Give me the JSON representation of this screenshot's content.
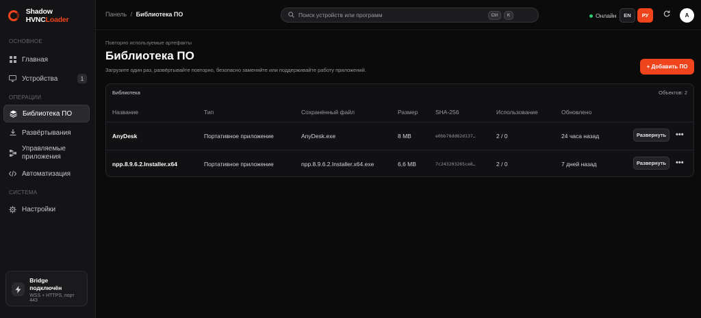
{
  "app": {
    "brand_main": "Shadow HVNC",
    "brand_accent": "Loader",
    "accent_color": "#f0451c"
  },
  "sidebar": {
    "sections": [
      {
        "label": "ОСНОВНОЕ",
        "items": [
          {
            "label": "Главная",
            "icon": "grid-icon"
          },
          {
            "label": "Устройства",
            "icon": "monitor-icon",
            "badge": "1"
          }
        ]
      },
      {
        "label": "ОПЕРАЦИИ",
        "items": [
          {
            "label": "Библиотека ПО",
            "icon": "layers-icon",
            "active": true
          },
          {
            "label": "Развёртывания",
            "icon": "download-icon"
          },
          {
            "label": "Управляемые приложения",
            "icon": "network-icon"
          },
          {
            "label": "Автоматизация",
            "icon": "code-icon"
          }
        ]
      },
      {
        "label": "СИСТЕМА",
        "items": [
          {
            "label": "Настройки",
            "icon": "gear-icon"
          }
        ]
      }
    ],
    "bridge": {
      "title_line1": "Bridge",
      "title_line2": "подключён",
      "subtitle": "WSS + HTTPS, порт 443",
      "icon": "bolt-icon"
    }
  },
  "topbar": {
    "breadcrumb_root": "Панель",
    "breadcrumb_sep": "/",
    "breadcrumb_current": "Библиотека ПО",
    "search_placeholder": "Поиск устройств или программ",
    "kbd_ctrl": "Ctrl",
    "kbd_k": "K",
    "status": "Онлайн",
    "status_color": "#2ecc71",
    "lang_en": "EN",
    "lang_ru": "РУ",
    "avatar": "A"
  },
  "main": {
    "eyebrow": "Повторно используемые артефакты",
    "title": "Библиотека ПО",
    "description": "Загрузите один раз, развёртывайте повторно, безопасно заменяйте или поддерживайте работу приложений.",
    "add_button": "+ Добавить ПО",
    "table": {
      "title": "Библиотека",
      "count": "Объектов: 2",
      "columns": [
        "Название",
        "Тип",
        "Сохранённый файл",
        "Размер",
        "SHA-256",
        "Использование",
        "Обновлено"
      ],
      "rows": [
        {
          "name": "AnyDesk",
          "type": "Портативное приложение",
          "file": "AnyDesk.exe",
          "size": "8 MB",
          "sha": "e0bb78dd82d137…",
          "usage": "2 / 0",
          "updated": "24 часа назад",
          "action": "Развернуть"
        },
        {
          "name": "npp.8.9.6.2.Installer.x64",
          "type": "Портативное приложение",
          "file": "npp.8.9.6.2.Installer.x64.exe",
          "size": "6,6 MB",
          "sha": "7c243203265ce8…",
          "usage": "2 / 0",
          "updated": "7 дней назад",
          "action": "Развернуть"
        }
      ]
    }
  }
}
